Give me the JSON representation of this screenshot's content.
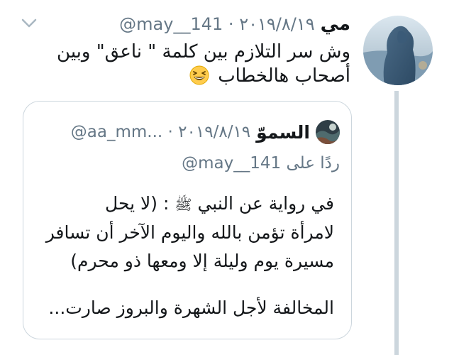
{
  "tweet": {
    "display_name": "مي",
    "handle": "@may__141",
    "separator": "·",
    "date": "٢٠١٩/٨/١٩",
    "text": "وش سر التلازم بين كلمة \" ناعق\" وبين أصحاب هالخطاب",
    "emoji": "grinning-squinting-face-icon"
  },
  "quoted_tweet": {
    "display_name": "السموّ",
    "handle": "@aa_mm...",
    "separator": "·",
    "date": "٢٠١٩/٨/١٩",
    "reply_prefix": "ردًا على",
    "reply_handle": "@may__141",
    "body_line1_before": "في رواية عن النبي",
    "body_honorific": "ﷺ",
    "body_line1_after": ": (لا يحل",
    "body_line2": "لامرأة تؤمن بالله واليوم الآخر أن تسافر",
    "body_line3": "مسيرة يوم وليلة إلا ومعها ذو محرم)",
    "body_line4": "المخالفة لأجل الشهرة والبروز صارت..."
  },
  "icons": {
    "more": "chevron-down-icon",
    "avatar": "avatar",
    "quoted_avatar": "avatar"
  },
  "colors": {
    "primary_text": "#14171a",
    "secondary_text": "#657786",
    "border": "#ccd6dd",
    "thread_line": "#ccd6dd"
  }
}
